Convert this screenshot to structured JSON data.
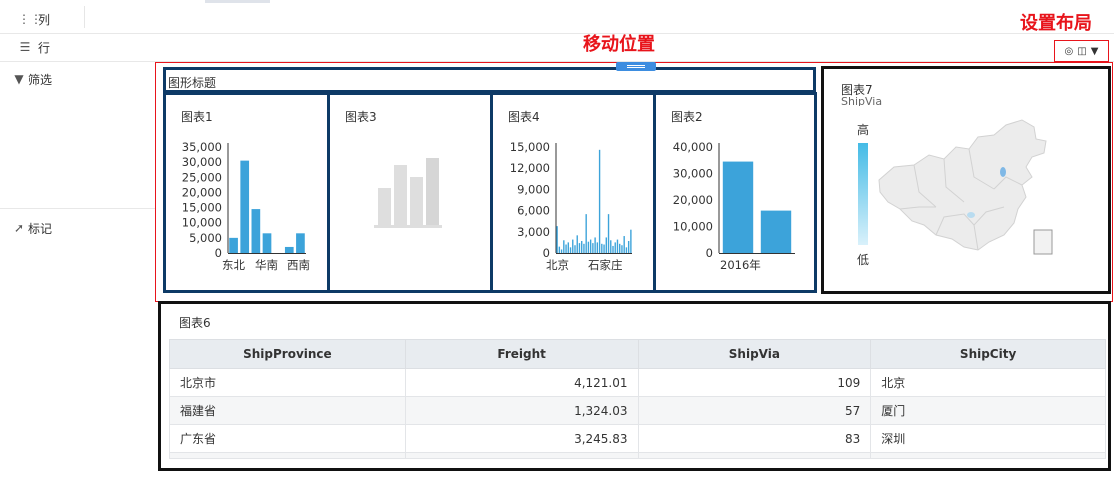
{
  "shelves": {
    "columns": {
      "icon": "columns-icon",
      "label": "列"
    },
    "rows": {
      "icon": "rows-icon",
      "label": "行"
    },
    "filter": {
      "icon": "filter-icon",
      "label": "筛选"
    },
    "marks": {
      "icon": "pin-icon",
      "label": "标记"
    }
  },
  "annotations": {
    "move_position": "移动位置",
    "set_layout": "设置布局"
  },
  "layout_control": {
    "icons": [
      "target-icon",
      "layout-icon",
      "dropdown-arrow-icon"
    ]
  },
  "container": {
    "title": "图形标题"
  },
  "charts": {
    "chart1": {
      "title": "图表1",
      "yticks": [
        "35,000",
        "30,000",
        "25,000",
        "20,000",
        "15,000",
        "10,000",
        "5,000",
        "0"
      ],
      "xticks": [
        "东北",
        "华南",
        "西南"
      ]
    },
    "chart3": {
      "title": "图表3"
    },
    "chart4": {
      "title": "图表4",
      "yticks": [
        "15,000",
        "12,000",
        "9,000",
        "6,000",
        "3,000",
        "0"
      ],
      "xticks": [
        "北京",
        "石家庄"
      ]
    },
    "chart2": {
      "title": "图表2",
      "yticks": [
        "40,000",
        "30,000",
        "20,000",
        "10,000",
        "0"
      ],
      "xticks": [
        "2016年"
      ]
    },
    "chart7": {
      "title": "图表7",
      "legend_title": "ShipVia",
      "legend_high": "高",
      "legend_low": "低"
    },
    "chart6": {
      "title": "图表6"
    }
  },
  "chart_data": [
    {
      "type": "bar",
      "title": "图表1",
      "ylim": [
        0,
        35000
      ],
      "x_labels_shown": [
        "东北",
        "华南",
        "西南"
      ],
      "values": [
        5000,
        30500,
        14500,
        6500,
        0,
        2000,
        6500
      ]
    },
    {
      "type": "bar",
      "title": "图表4",
      "ylim": [
        0,
        15000
      ],
      "x_labels_shown": [
        "北京",
        "石家庄"
      ],
      "values": [
        3800,
        900,
        500,
        1800,
        1200,
        1500,
        800,
        1900,
        1100,
        2500,
        1400,
        1700,
        1300,
        5500,
        1600,
        1900,
        1400,
        2200,
        1500,
        14600,
        1300,
        1200,
        2200,
        5500,
        1800,
        1000,
        1500,
        1900,
        1300,
        1100,
        2400,
        800,
        1700,
        3300
      ]
    },
    {
      "type": "bar",
      "title": "图表2",
      "ylim": [
        0,
        40000
      ],
      "x_labels_shown": [
        "2016年"
      ],
      "values": [
        34500,
        16000
      ]
    }
  ],
  "table": {
    "headers": [
      "ShipProvince",
      "Freight",
      "ShipVia",
      "ShipCity"
    ],
    "rows": [
      [
        "北京市",
        "4,121.01",
        "109",
        "北京"
      ],
      [
        "福建省",
        "1,324.03",
        "57",
        "厦门"
      ],
      [
        "广东省",
        "3,245.83",
        "83",
        "深圳"
      ]
    ]
  },
  "colors": {
    "bar": "#3ca3da",
    "frame_dark": "#0d3a66",
    "annotation_red": "#e8141b",
    "placeholder_bar": "#d9d9d9"
  }
}
